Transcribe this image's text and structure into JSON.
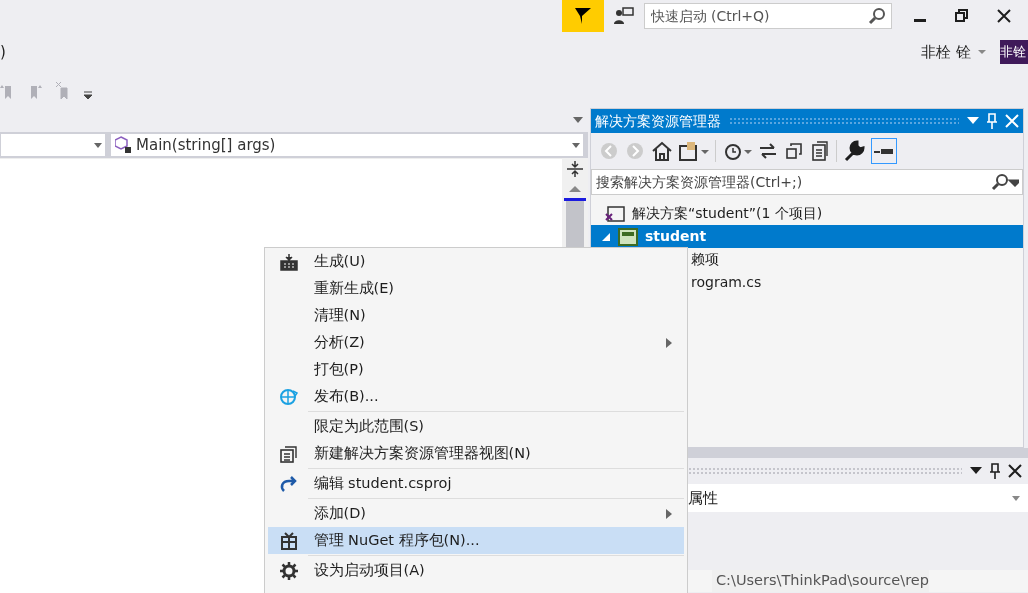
{
  "title_bar": {
    "quick_launch": {
      "placeholder": "快速启动 (Ctrl+Q)"
    }
  },
  "menu_row": {
    "left_text": ")",
    "user_name": "非栓 铨",
    "avatar": "非铨"
  },
  "editor": {
    "member_dropdown": "Main(string[] args)"
  },
  "solution_explorer": {
    "title": "解决方案资源管理器",
    "search": {
      "placeholder": "搜索解决方案资源管理器(Ctrl+;)"
    },
    "tree": [
      {
        "label": "解决方案“student”(1 个项目)",
        "selected": false,
        "children": [
          {
            "label": "student",
            "selected": true,
            "children": [
              {
                "label": "赖项",
                "selected": false
              },
              {
                "label": "rogram.cs",
                "selected": false
              }
            ]
          }
        ]
      }
    ]
  },
  "properties": {
    "object": "属性",
    "path": "C:\\Users\\ThinkPad\\source\\rep"
  },
  "context_menu": [
    {
      "kind": "item",
      "label": "生成(U)",
      "submenu": false,
      "selected": false
    },
    {
      "kind": "item",
      "label": "重新生成(E)",
      "submenu": false,
      "selected": false
    },
    {
      "kind": "item",
      "label": "清理(N)",
      "submenu": false,
      "selected": false
    },
    {
      "kind": "item",
      "label": "分析(Z)",
      "submenu": true,
      "selected": false
    },
    {
      "kind": "item",
      "label": "打包(P)",
      "submenu": false,
      "selected": false
    },
    {
      "kind": "item",
      "label": "发布(B)...",
      "submenu": false,
      "selected": false
    },
    {
      "kind": "separator"
    },
    {
      "kind": "item",
      "label": "限定为此范围(S)",
      "submenu": false,
      "selected": false
    },
    {
      "kind": "item",
      "label": "新建解决方案资源管理器视图(N)",
      "submenu": false,
      "selected": false
    },
    {
      "kind": "separator"
    },
    {
      "kind": "item",
      "label": "编辑 student.csproj",
      "submenu": false,
      "selected": false
    },
    {
      "kind": "separator"
    },
    {
      "kind": "item",
      "label": "添加(D)",
      "submenu": true,
      "selected": false
    },
    {
      "kind": "item",
      "label": "管理 NuGet 程序包(N)...",
      "submenu": false,
      "selected": true
    },
    {
      "kind": "separator"
    },
    {
      "kind": "item",
      "label": "设为启动项目(A)",
      "submenu": false,
      "selected": false
    }
  ]
}
